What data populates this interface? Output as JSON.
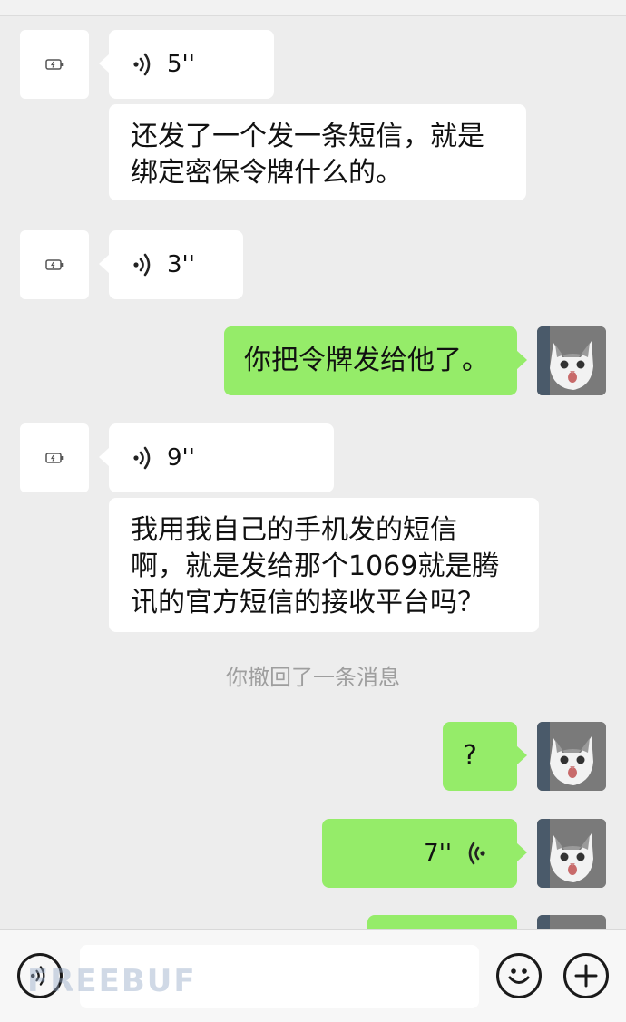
{
  "messages": {
    "m1_voice": {
      "duration": "5''"
    },
    "m2_text": {
      "line1": "还发了一个发一条短信，就是",
      "line2": "绑定密保令牌什么的。"
    },
    "m3_voice": {
      "duration": "3''"
    },
    "m4_text": {
      "text": "你把令牌发给他了。"
    },
    "m5_voice": {
      "duration": "9''"
    },
    "m6_text": {
      "line1": "我用我自己的手机发的短信",
      "line2": "啊，就是发给那个1069就是腾",
      "line3": "讯的官方短信的接收平台吗？"
    },
    "system_notice": "你撤回了一条消息",
    "m7_text": {
      "text": "?"
    },
    "m8_voice": {
      "duration": "7''"
    }
  },
  "watermark": "FREEBUF",
  "icons": {
    "voice_toggle": "voice-icon",
    "emoji": "emoji-icon",
    "more": "plus-icon"
  },
  "colors": {
    "background": "#ededed",
    "incoming_bubble": "#ffffff",
    "outgoing_bubble": "#95ec69"
  }
}
